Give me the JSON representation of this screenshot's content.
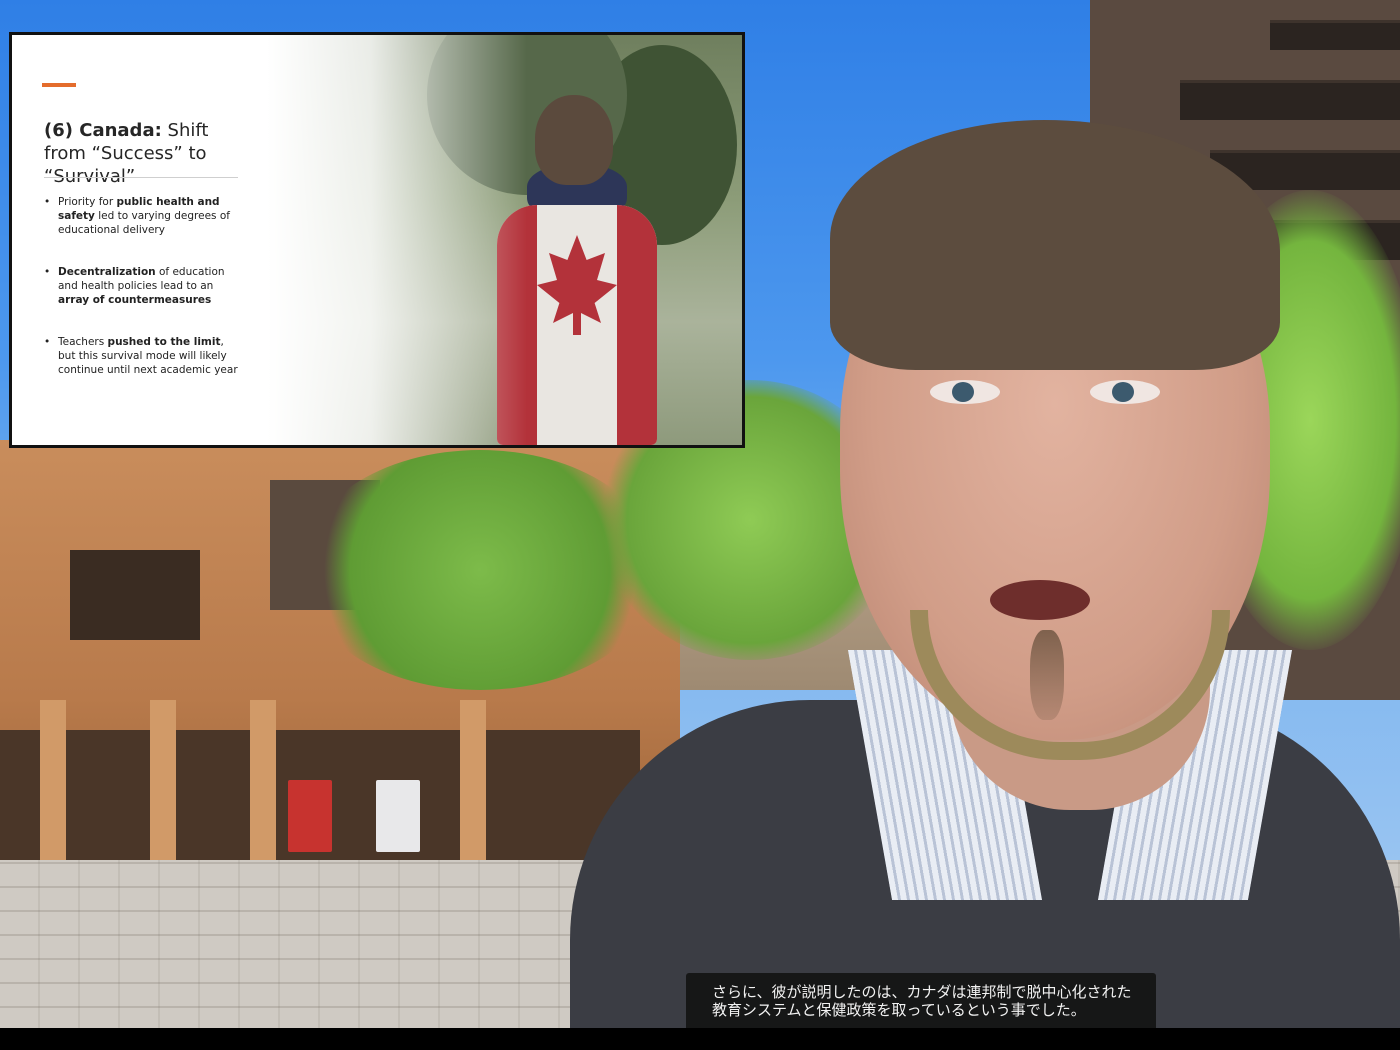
{
  "slide": {
    "title_bold": "(6) Canada:",
    "title_rest": " Shift from “Success” to “Survival”",
    "bullets": [
      {
        "p1": "Priority for ",
        "b1": "public health and safety",
        "p2": " led to varying degrees of educational delivery",
        "b2": "",
        "p3": ""
      },
      {
        "p1": "",
        "b1": "Decentralization",
        "p2": " of education and health policies lead to an ",
        "b2": "array of countermeasures",
        "p3": ""
      },
      {
        "p1": "Teachers ",
        "b1": "pushed to the limit",
        "p2": ", but this survival mode will likely continue until next academic year",
        "b2": "",
        "p3": ""
      }
    ],
    "accent_color": "#e46c2c"
  },
  "caption": {
    "text": "さらに、彼が説明したのは、カナダは連邦制で脱中心化された教育システムと保健政策を取っているという事でした。"
  }
}
